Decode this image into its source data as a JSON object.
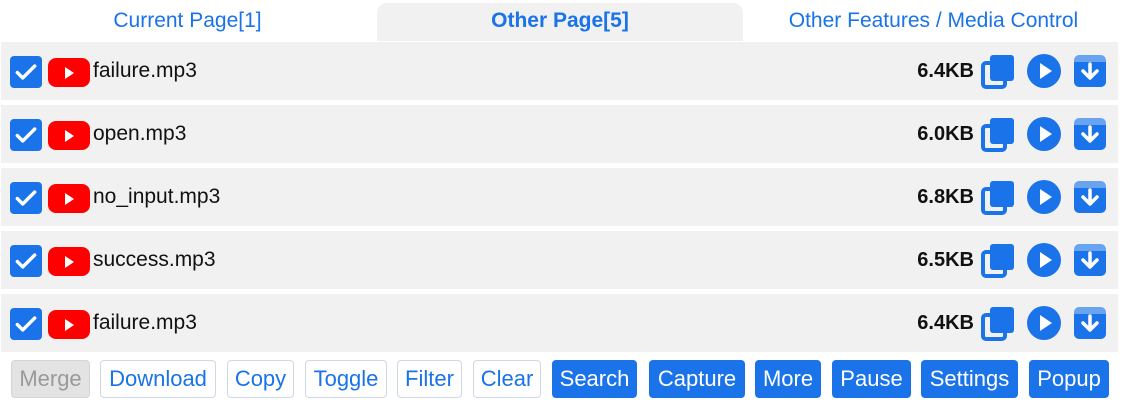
{
  "tabs": [
    {
      "label": "Current Page[1]",
      "active": false
    },
    {
      "label": "Other Page[5]",
      "active": true
    },
    {
      "label": "Other Features / Media Control",
      "active": false
    }
  ],
  "files": [
    {
      "name": "failure.mp3",
      "size": "6.4KB",
      "checked": true
    },
    {
      "name": "open.mp3",
      "size": "6.0KB",
      "checked": true
    },
    {
      "name": "no_input.mp3",
      "size": "6.8KB",
      "checked": true
    },
    {
      "name": "success.mp3",
      "size": "6.5KB",
      "checked": true
    },
    {
      "name": "failure.mp3",
      "size": "6.4KB",
      "checked": true
    }
  ],
  "row_icons": {
    "source": "youtube-icon",
    "actions": [
      "copy-icon",
      "play-icon",
      "download-icon"
    ]
  },
  "toolbar": {
    "merge": "Merge",
    "download": "Download",
    "copy": "Copy",
    "toggle": "Toggle",
    "filter": "Filter",
    "clear": "Clear",
    "search": "Search",
    "capture": "Capture",
    "more": "More",
    "pause": "Pause",
    "settings": "Settings",
    "popup": "Popup"
  },
  "colors": {
    "accent": "#1a73e8",
    "youtube": "#ff0000",
    "row_bg": "#f1f1f1",
    "disabled_bg": "#e3e3e3"
  }
}
